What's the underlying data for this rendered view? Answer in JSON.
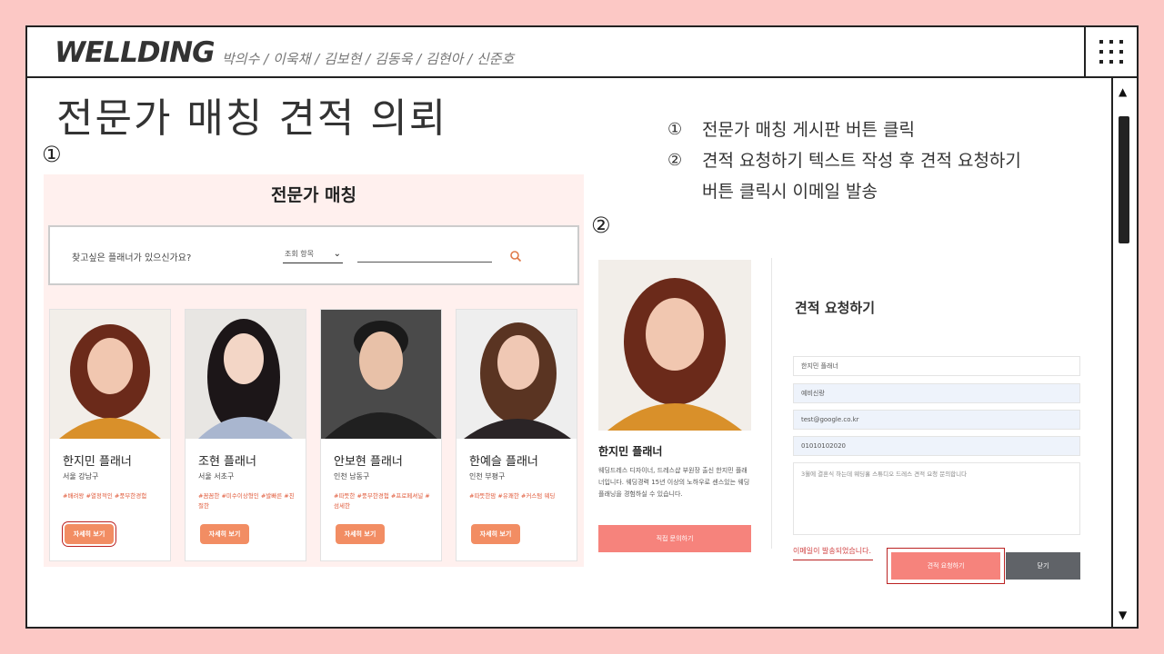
{
  "header": {
    "brand": "WELLDING",
    "members": "박의수 / 이욱채 / 김보현 / 김동욱 / 김현아 / 신준호"
  },
  "scrollbar": {
    "up_icon": "▲",
    "down_icon": "▼"
  },
  "page_title": "전문가 매칭 견적 의뢰",
  "step_markers": {
    "one": "①",
    "two": "②"
  },
  "notes": [
    {
      "num": "①",
      "text": "전문가 매칭 게시판 버튼 클릭"
    },
    {
      "num": "②",
      "text": "견적 요청하기 텍스트 작성 후 견적 요청하기"
    }
  ],
  "notes_continuation": "버튼 클릭시 이메일 발송",
  "expert_matching": {
    "title": "전문가 매칭",
    "search_prompt": "찾고싶은 플래너가 있으신가요?",
    "search_select": "조회 항목",
    "planners": [
      {
        "name": "한지민 플래너",
        "area": "서울 강남구",
        "tags": "#배려왕 #열정적인 #풍부한경험",
        "button": "자세히 보기",
        "hair": "#6b2a1a",
        "top": "#d9902a",
        "bg": "#f2eee9"
      },
      {
        "name": "조현 플래너",
        "area": "서울 서초구",
        "tags": "#꼼꼼한 #미수이상형인 #발빠른 #친절한",
        "button": "자세히 보기",
        "hair": "#1c1618",
        "top": "#a9b6cf",
        "bg": "#e8e6e3"
      },
      {
        "name": "안보현 플래너",
        "area": "인천 남동구",
        "tags": "#따뜻한 #풍부한경험 #프로페셔널 #섬세한",
        "button": "자세히 보기",
        "hair": "#1a1a1a",
        "top": "#202020",
        "bg": "#4a4a4a"
      },
      {
        "name": "한예슬 플래너",
        "area": "인천 부평구",
        "tags": "#따뜻한맘 #유쾌한 #커스텀 웨딩",
        "button": "자세히 보기",
        "hair": "#5a3422",
        "top": "#2a2426",
        "bg": "#eeeeee"
      }
    ]
  },
  "request_form": {
    "planner_name": "한지민 플래너",
    "planner_desc": "웨딩드레스 디자이너, 드레스샵 부원장 출신 한지민 플래너입니다. 웨딩경력 15년 이상의 노하우로 센스있는 웨딩 플래닝을 경험하실 수 있습니다.",
    "contact_button": "직접 문의하기",
    "heading": "견적 요청하기",
    "field_planner": "한지민 플래너",
    "field_name": "예비신랑",
    "field_email": "test@google.co.kr",
    "field_phone": "01010102020",
    "message": "3월에 결혼식 하는데 웨딩홀 스튜디오 드레스 견적 요청 문의합니다",
    "status": "이메일이 발송되었습니다.",
    "submit_button": "견적 요청하기",
    "close_button": "닫기"
  }
}
